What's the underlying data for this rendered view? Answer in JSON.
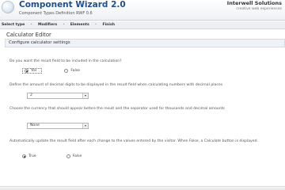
{
  "header": {
    "title": "Component Wizard 2.0",
    "subtitle": "Component Types Definition RWF 0.6",
    "brand": "Interwell Solutions",
    "brand_tagline": "creative web experiences"
  },
  "nav": {
    "items": [
      "Select type",
      "Modifiers",
      "Elements",
      "Finish"
    ]
  },
  "section": {
    "title": "Calculator Editor",
    "subtitle": "Configure calculator settings"
  },
  "questions": [
    {
      "type": "radio",
      "text": "Do you want the result field to be included in the calculation?",
      "options": [
        {
          "label": "Yes",
          "selected": true
        },
        {
          "label": "False",
          "selected": false
        }
      ]
    },
    {
      "type": "select",
      "text": "Define the amount of decimal digits to be displayed in the result field when calculating numbers with decimal places",
      "value": "2"
    },
    {
      "type": "select",
      "text": "Choose the currency that should appear before the result and the separator used for thousands and decimal amounts",
      "value": "None"
    },
    {
      "type": "radio",
      "text": "Automatically update the result field after each change to the values entered by the visitor. When False, a Calculate button is displayed.",
      "options": [
        {
          "label": "True",
          "selected": true
        },
        {
          "label": "False",
          "selected": false
        }
      ]
    }
  ]
}
